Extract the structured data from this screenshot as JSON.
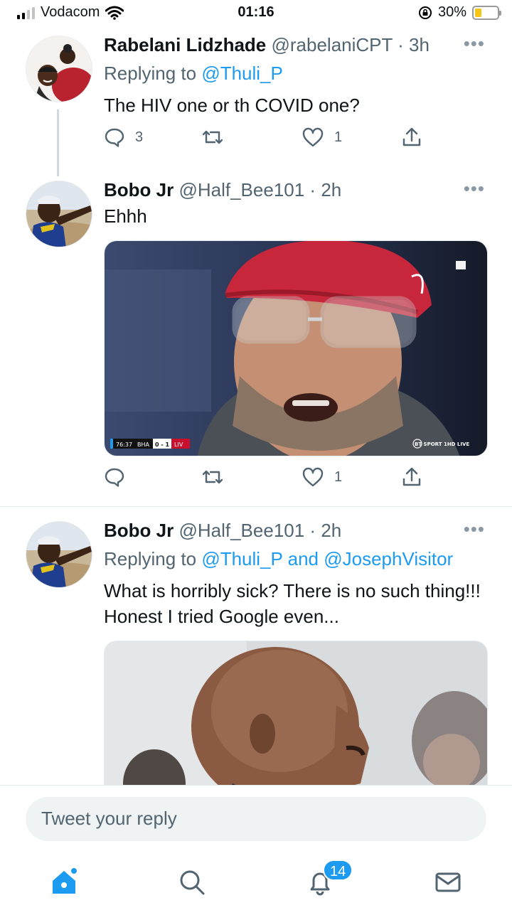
{
  "status_bar": {
    "carrier": "Vodacom",
    "time": "01:16",
    "battery": "30%",
    "battery_level": 0.3
  },
  "tweets": [
    {
      "name": "Rabelani Lidzhade",
      "handle": "@rabelaniCPT",
      "time": "3h",
      "replying_prefix": "Replying to ",
      "replying_to": "@Thuli_P",
      "text": "The HIV one or th COVID one?",
      "replies": "3",
      "retweets": "",
      "likes": "1"
    },
    {
      "name": "Bobo Jr",
      "handle": "@Half_Bee101",
      "time": "2h",
      "text": "Ehhh",
      "media_scoreboard": {
        "clock": "76:37",
        "home": "BHA",
        "score": "0 - 1",
        "away": "LIV",
        "broadcaster": "BT SPORT 1HD LIVE"
      },
      "replies": "",
      "retweets": "",
      "likes": "1"
    },
    {
      "name": "Bobo Jr",
      "handle": "@Half_Bee101",
      "time": "2h",
      "replying_prefix": "Replying to ",
      "replying_to": "@Thuli_P and @JosephVisitor",
      "text": "What is horribly sick? There is no such thing!!! Honest I tried Google even..."
    }
  ],
  "reply_bar": {
    "placeholder": "Tweet your reply"
  },
  "tabs": {
    "notifications_badge": "14"
  },
  "colors": {
    "accent": "#1d9bf0",
    "text": "#0f1419",
    "secondary": "#536471"
  }
}
